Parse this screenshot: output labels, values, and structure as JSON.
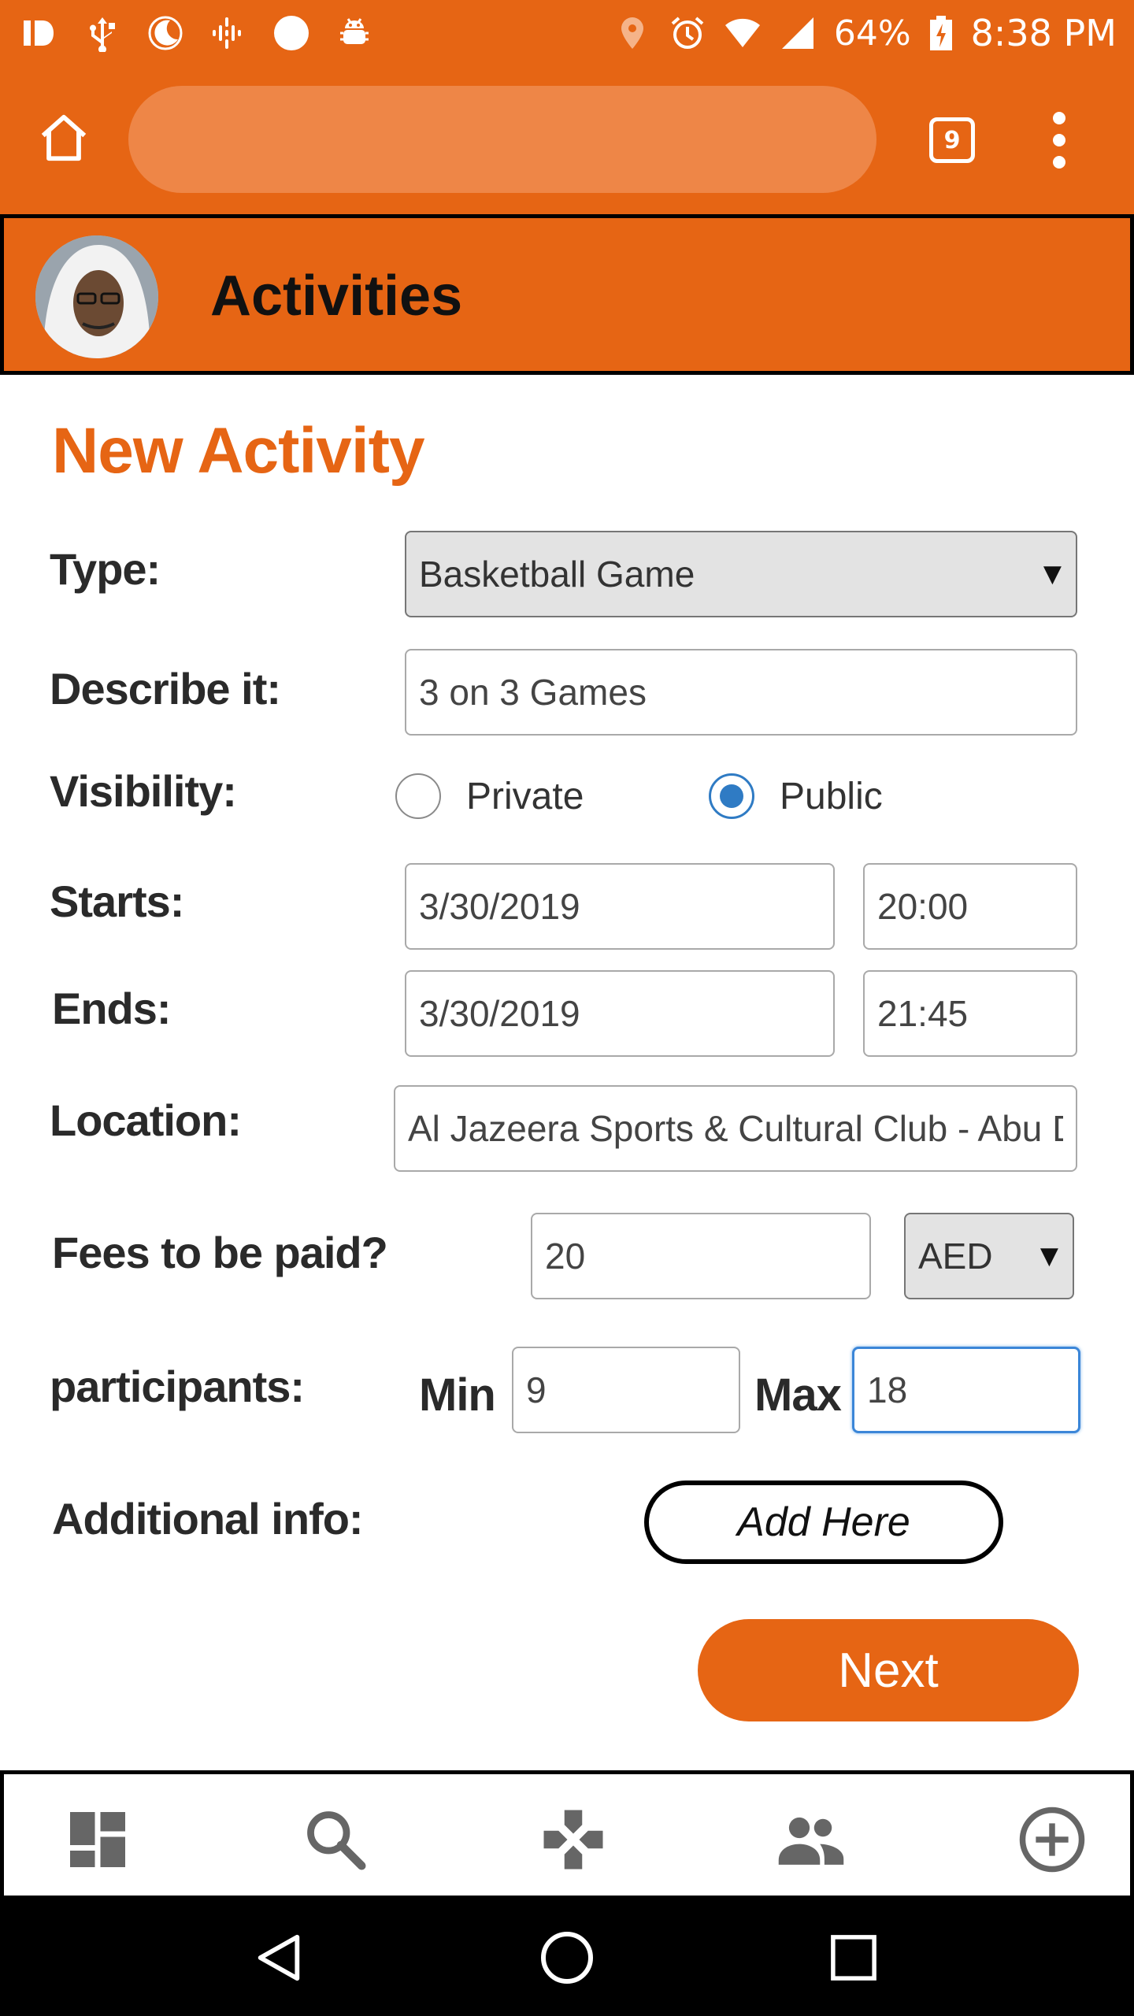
{
  "status_bar": {
    "battery": "64%",
    "time": "8:38 PM",
    "icons": [
      "id-icon",
      "usb-icon",
      "moon-icon",
      "podcast-icon",
      "circle-icon",
      "android-debug-icon",
      "location-icon",
      "alarm-icon",
      "wifi-icon",
      "signal-icon",
      "battery-charging-icon"
    ]
  },
  "browser": {
    "url": "",
    "tab_count": "9",
    "icons": [
      "home-icon",
      "more-vert-icon"
    ]
  },
  "header": {
    "title": "Activities"
  },
  "form": {
    "page_title": "New Activity",
    "type": {
      "label": "Type:",
      "value": "Basketball Game"
    },
    "describe": {
      "label": "Describe it:",
      "value": "3 on 3 Games"
    },
    "visibility": {
      "label": "Visibility:",
      "options": [
        "Private",
        "Public"
      ],
      "selected": "Public"
    },
    "starts": {
      "label": "Starts:",
      "date": "3/30/2019",
      "time": "20:00"
    },
    "ends": {
      "label": "Ends:",
      "date": "3/30/2019",
      "time": "21:45"
    },
    "location": {
      "label": "Location:",
      "value": "Al Jazeera Sports & Cultural Club - Abu Dhabi"
    },
    "fees": {
      "label": "Fees to be paid?",
      "amount": "20",
      "currency": "AED"
    },
    "participants": {
      "label": "participants:",
      "min_label": "Min",
      "min": "9",
      "max_label": "Max",
      "max": "18"
    },
    "additional": {
      "label": "Additional info:",
      "button": "Add Here"
    },
    "next_button": "Next"
  },
  "tab_bar": {
    "tabs": [
      "dashboard-icon",
      "search-icon",
      "gamepad-icon",
      "people-icon",
      "add-circle-icon"
    ]
  },
  "nav_bar": {
    "buttons": [
      "back-icon",
      "home-circle-icon",
      "recents-icon"
    ]
  },
  "colors": {
    "accent": "#e66514",
    "radio_selected": "#2f7bc4",
    "focus": "#3b86d8"
  }
}
